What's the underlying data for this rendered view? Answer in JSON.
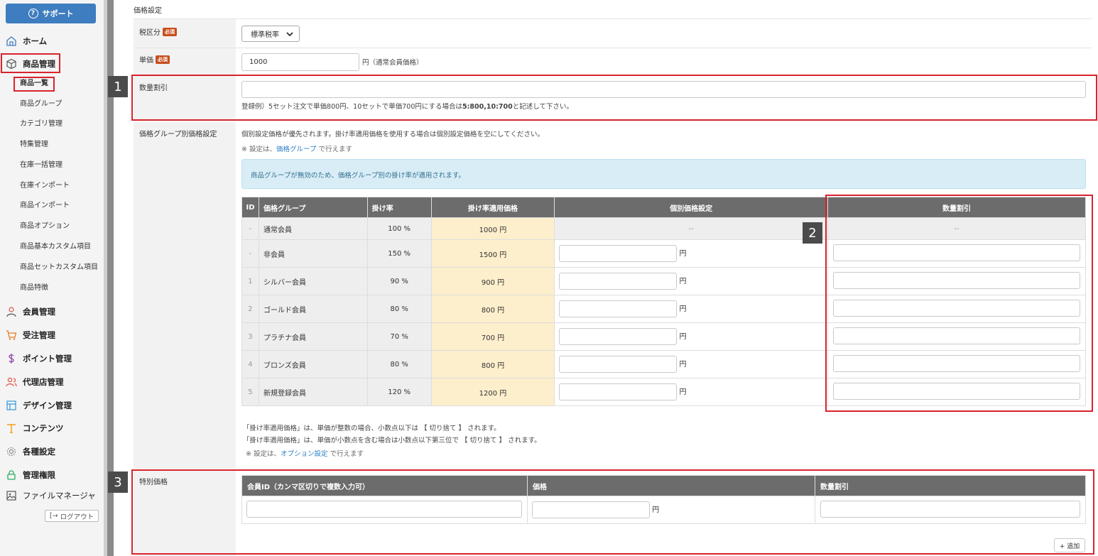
{
  "sidebar": {
    "support_label": "サポート",
    "items": [
      {
        "label": "ホーム",
        "icon": "home-icon"
      },
      {
        "label": "商品管理",
        "icon": "box-icon"
      },
      {
        "label": "会員管理",
        "icon": "user-icon"
      },
      {
        "label": "受注管理",
        "icon": "cart-icon"
      },
      {
        "label": "ポイント管理",
        "icon": "dollar-icon"
      },
      {
        "label": "代理店管理",
        "icon": "users-icon"
      },
      {
        "label": "デザイン管理",
        "icon": "layout-icon"
      },
      {
        "label": "コンテンツ",
        "icon": "type-icon"
      },
      {
        "label": "各種設定",
        "icon": "gear-icon"
      },
      {
        "label": "管理権限",
        "icon": "lock-icon"
      },
      {
        "label": "ファイルマネージャ",
        "icon": "image-icon"
      }
    ],
    "sub_items": [
      "商品一覧",
      "商品グループ",
      "カテゴリ管理",
      "特集管理",
      "在庫一括管理",
      "在庫インポート",
      "商品インポート",
      "商品オプション",
      "商品基本カスタム項目",
      "商品セットカスタム項目",
      "商品特徴"
    ],
    "logout_label": "ログアウト"
  },
  "price_settings": {
    "title": "価格設定",
    "tax_label": "税区分",
    "required": "必須",
    "tax_value": "標準税率",
    "unit_price_label": "単価",
    "unit_price_value": "1000",
    "unit_price_suffix": "円（通常会員価格）",
    "qty_discount_label": "数量割引",
    "qty_discount_hint_pre": "登録例）5セット注文で単価800円、10セットで単価700円にする場合は",
    "qty_discount_hint_bold": "5:800,10:700",
    "qty_discount_hint_post": "と記述して下さい。"
  },
  "group_pricing": {
    "label": "価格グループ別価格設定",
    "note1": "個別設定価格が優先されます。掛け率適用価格を使用する場合は個別設定価格を空にしてください。",
    "note2_pre": "※ 設定は、",
    "note2_link": "価格グループ",
    "note2_post": "で行えます",
    "info": "商品グループが無効のため、価格グループ別の掛け率が適用されます。",
    "headers": [
      "ID",
      "価格グループ",
      "掛け率",
      "掛け率適用価格",
      "個別価格設定",
      "数量割引"
    ],
    "rows": [
      {
        "id": "-",
        "group": "通常会員",
        "rate": "100 %",
        "price": "1000 円",
        "individual": "--",
        "qty": "--"
      },
      {
        "id": "-",
        "group": "非会員",
        "rate": "150 %",
        "price": "1500 円"
      },
      {
        "id": "1",
        "group": "シルバー会員",
        "rate": "90 %",
        "price": "900 円"
      },
      {
        "id": "2",
        "group": "ゴールド会員",
        "rate": "80 %",
        "price": "800 円"
      },
      {
        "id": "3",
        "group": "プラチナ会員",
        "rate": "70 %",
        "price": "700 円"
      },
      {
        "id": "4",
        "group": "ブロンズ会員",
        "rate": "80 %",
        "price": "800 円"
      },
      {
        "id": "5",
        "group": "新規登録会員",
        "rate": "120 %",
        "price": "1200 円"
      }
    ],
    "yen": "円",
    "footnote1": "「掛け率適用価格」は、単価が整数の場合、小数点以下は 【 切り捨て 】 されます。",
    "footnote2": "「掛け率適用価格」は、単価が小数点を含む場合は小数点以下第三位で 【 切り捨て 】 されます。",
    "footnote3_pre": "※ 設定は、",
    "footnote3_link": "オプション設定",
    "footnote3_post": "で行えます"
  },
  "special_price": {
    "label": "特別価格",
    "headers": [
      "会員ID（カンマ区切りで複数入力可）",
      "価格",
      "数量割引"
    ],
    "yen": "円",
    "add_label": "+ 追加"
  },
  "annotations": [
    "1",
    "2",
    "3"
  ]
}
